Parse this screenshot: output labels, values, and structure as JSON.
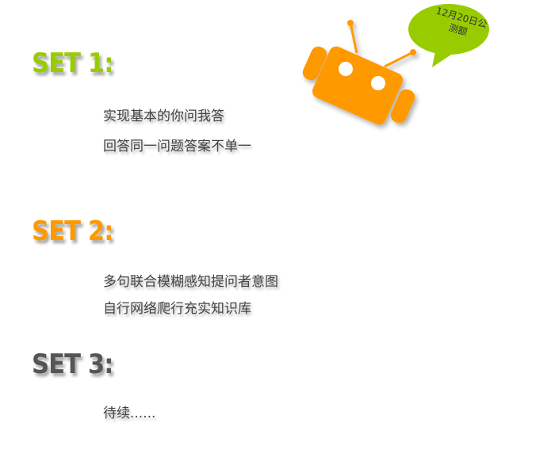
{
  "sections": [
    {
      "title": "SET 1:",
      "color": "#99cc00",
      "items": [
        "实现基本的你问我答",
        "回答同一问题答案不单一"
      ]
    },
    {
      "title": "SET 2:",
      "color": "#ff9900",
      "items": [
        "多句联合模糊感知提问者意图",
        "自行网络爬行充实知识库"
      ]
    },
    {
      "title": "SET 3:",
      "color": "#555555",
      "items": [
        "待续......"
      ]
    }
  ],
  "bubble": {
    "line1": "12月20日公",
    "line2": "测额",
    "color": "#99cc00"
  },
  "robot": {
    "color": "#ff9900"
  }
}
